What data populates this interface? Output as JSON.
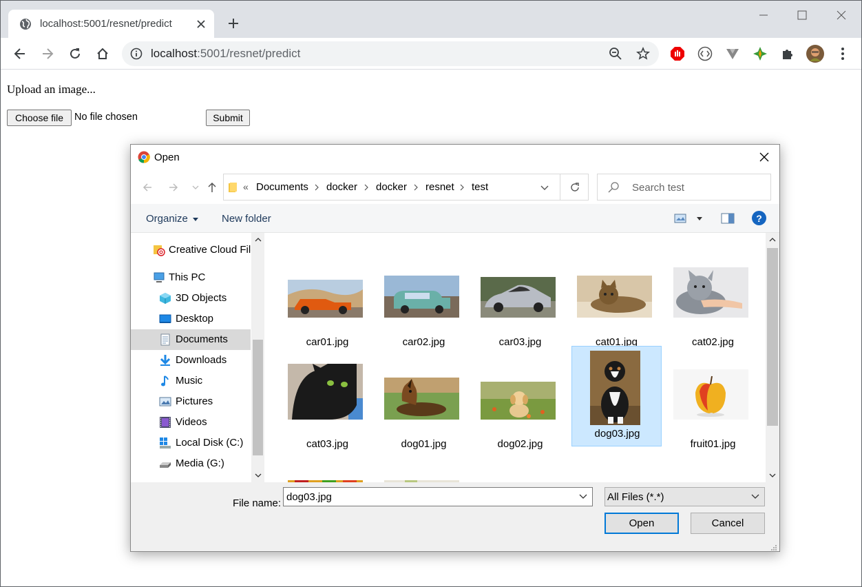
{
  "browser": {
    "tab_title": "localhost:5001/resnet/predict",
    "url_host": "localhost",
    "url_rest": ":5001/resnet/predict"
  },
  "page": {
    "heading": "Upload an image...",
    "choose_file_label": "Choose file",
    "no_file_text": "No file chosen",
    "submit_label": "Submit"
  },
  "dialog": {
    "title": "Open",
    "breadcrumb": [
      "Documents",
      "docker",
      "docker",
      "resnet",
      "test"
    ],
    "search_placeholder": "Search test",
    "organize_label": "Organize",
    "new_folder_label": "New folder",
    "help_glyph": "?",
    "nav_items": [
      {
        "label": "Creative Cloud Files",
        "icon": "creative-cloud-icon"
      },
      {
        "label": "This PC",
        "icon": "pc-icon"
      },
      {
        "label": "3D Objects",
        "icon": "3d-objects-icon"
      },
      {
        "label": "Desktop",
        "icon": "desktop-icon"
      },
      {
        "label": "Documents",
        "icon": "documents-icon",
        "selected": true
      },
      {
        "label": "Downloads",
        "icon": "downloads-icon"
      },
      {
        "label": "Music",
        "icon": "music-icon"
      },
      {
        "label": "Pictures",
        "icon": "pictures-icon"
      },
      {
        "label": "Videos",
        "icon": "videos-icon"
      },
      {
        "label": "Local Disk (C:)",
        "icon": "local-disk-icon"
      },
      {
        "label": "Media (G:)",
        "icon": "drive-icon"
      }
    ],
    "files": [
      {
        "name": "car01.jpg"
      },
      {
        "name": "car02.jpg"
      },
      {
        "name": "car03.jpg"
      },
      {
        "name": "cat01.jpg"
      },
      {
        "name": "cat02.jpg"
      },
      {
        "name": "cat03.jpg"
      },
      {
        "name": "dog01.jpg"
      },
      {
        "name": "dog02.jpg"
      },
      {
        "name": "dog03.jpg",
        "selected": true
      },
      {
        "name": "fruit01.jpg"
      }
    ],
    "file_name_label": "File name:",
    "file_name_value": "dog03.jpg",
    "file_type_value": "All Files (*.*)",
    "open_label": "Open",
    "cancel_label": "Cancel"
  },
  "colors": {
    "selection_bg": "#cce8ff",
    "primary_border": "#0078d7",
    "help_blue": "#1565c0"
  }
}
